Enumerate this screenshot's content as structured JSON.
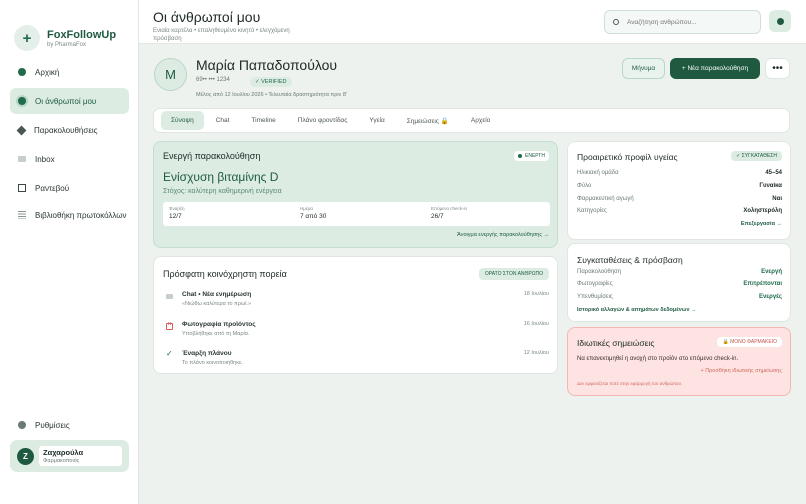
{
  "brand": {
    "name": "FoxFollowUp",
    "subtitle": "by PharmaFox",
    "logo_icon": "plus-icon"
  },
  "sidebar": {
    "items": [
      {
        "label": "Αρχική",
        "icon": "dot-icon"
      },
      {
        "label": "Οι άνθρωποί μου",
        "icon": "people-icon",
        "active": true
      },
      {
        "label": "Παρακολουθήσεις",
        "icon": "diamond-icon"
      },
      {
        "label": "Inbox",
        "icon": "inbox-icon"
      },
      {
        "label": "Ραντεβού",
        "icon": "calendar-icon"
      },
      {
        "label": "Βιβλιοθήκη πρωτοκόλλων",
        "icon": "library-icon"
      }
    ],
    "settings_label": "Ρυθμίσεις",
    "user": {
      "initial": "Z",
      "name": "Ζαχαρούλα",
      "role": "Φαρμακοποιός"
    }
  },
  "topbar": {
    "title": "Οι άνθρωποί μου",
    "subtitle": "Ενιαία καρτέλα • επαληθευμένο κινητό • ελεγχόμενη πρόσβαση",
    "search_placeholder": "Αναζήτηση ανθρώπου..."
  },
  "patient": {
    "initial": "M",
    "name": "Μαρία Παπαδοπούλου",
    "phone": "69•• ••• 1234",
    "verified": "✓ VERIFIED",
    "member_since": "Μέλος από 12 Ιουλίου 2026 • Τελευταία δραστηριότητα πριν 8'",
    "message_label": "Μήνυμα",
    "new_followup_label": "+ Νέα παρακολούθηση",
    "more_label": "•••"
  },
  "tabs": [
    "Σύνοψη",
    "Chat",
    "Timeline",
    "Πλάνο φροντίδας",
    "Υγεία",
    "Σημειώσεις 🔒",
    "Αρχείο"
  ],
  "active_followup": {
    "header": "Ενεργή παρακολούθηση",
    "badge": "ΕΝΕΡΓΗ",
    "title": "Ενίσχυση βιταμίνης D",
    "goal": "Στόχος: καλύτερη καθημερινή ενέργεια",
    "stats": [
      {
        "label": "Έναρξη",
        "value": "12/7"
      },
      {
        "label": "Ημέρα",
        "value": "7 από 30"
      },
      {
        "label": "Επόμενο check-in",
        "value": "26/7"
      }
    ],
    "link": "Άνοιγμα ενεργής παρακολούθησης →"
  },
  "recent": {
    "title": "Πρόσφατη κοινόχρηστη πορεία",
    "badge": "ΟΡΑΤΟ ΣΤΟΝ ΑΝΘΡΩΠΟ",
    "items": [
      {
        "icon": "chat-icon",
        "title": "Chat • Νέα ενημέρωση",
        "sub": "«Νιώθω καλύτερα το πρωί.»",
        "date": "18 Ιουλίου"
      },
      {
        "icon": "photo-icon",
        "title": "Φωτογραφία προϊόντος",
        "sub": "Υποβλήθηκε από τη Μαρία.",
        "date": "16 Ιουλίου"
      },
      {
        "icon": "check-icon",
        "title": "Έναρξη πλάνου",
        "sub": "Το πλάνο κοινοποιήθηκε.",
        "date": "12 Ιουλίου"
      }
    ]
  },
  "health_profile": {
    "title": "Προαιρετικό προφίλ υγείας",
    "badge": "✓ ΣΥΓΚΑΤΑΘΕΣΗ",
    "rows": [
      {
        "k": "Ηλικιακή ομάδα",
        "v": "45–54"
      },
      {
        "k": "Φύλο",
        "v": "Γυναίκα"
      },
      {
        "k": "Φαρμακευτική αγωγή",
        "v": "Ναι"
      },
      {
        "k": "Κατηγορίες",
        "v": "Χοληστερόλη"
      }
    ],
    "link": "Επεξεργασία →"
  },
  "consents": {
    "title": "Συγκαταθέσεις & πρόσβαση",
    "rows": [
      {
        "k": "Παρακολούθηση",
        "v": "Ενεργή"
      },
      {
        "k": "Φωτογραφίες",
        "v": "Επιτρέπονται"
      },
      {
        "k": "Υπενθυμίσεις",
        "v": "Ενεργές"
      }
    ],
    "link": "Ιστορικό αλλαγών & αιτημάτων δεδομένων →"
  },
  "private_notes": {
    "title": "Ιδιωτικές σημειώσεις",
    "badge": "🔒 ΜΟΝΟ ΦΑΡΜΑΚΕΙΟ",
    "text": "Να επανεκτιμηθεί η ανοχή στο προϊόν στο επόμενο check-in.",
    "link": "+ Προσθήκη ιδιωτικής σημείωσης",
    "footer": "Δεν εμφανίζεται ποτέ στην εφαρμογή του ανθρώπου."
  },
  "colors": {
    "accent": "#1f5a40",
    "accent_light": "#dcece3",
    "danger_light": "#fde3e1"
  }
}
